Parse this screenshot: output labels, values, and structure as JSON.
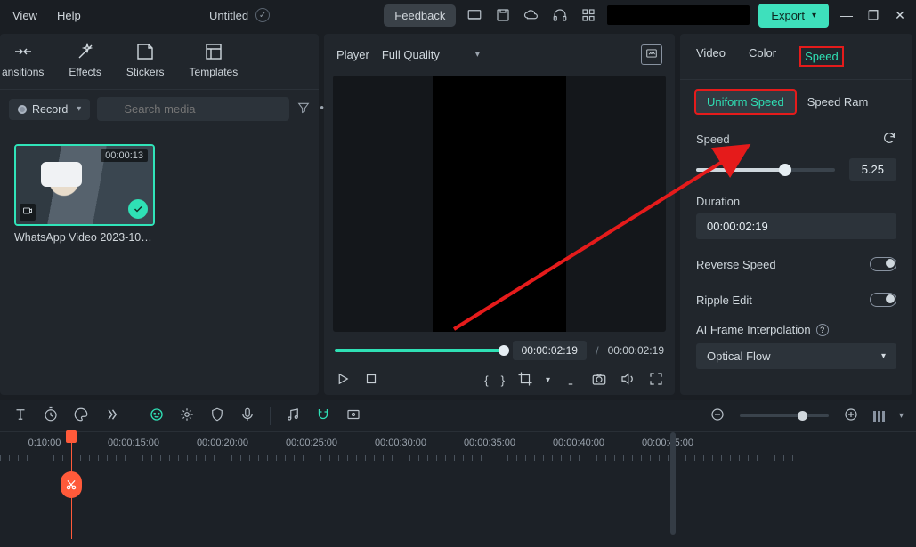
{
  "menubar": {
    "view": "View",
    "help": "Help",
    "title": "Untitled"
  },
  "topbar": {
    "feedback": "Feedback",
    "export": "Export"
  },
  "categories": {
    "transitions": "ansitions",
    "effects": "Effects",
    "stickers": "Stickers",
    "templates": "Templates"
  },
  "media": {
    "record": "Record",
    "search_placeholder": "Search media",
    "clip_duration": "00:00:13",
    "clip_name": "WhatsApp Video 2023-10-05..."
  },
  "player": {
    "label": "Player",
    "quality": "Full Quality",
    "time_current": "00:00:02:19",
    "time_total": "00:00:02:19"
  },
  "rpanel": {
    "tabs": {
      "video": "Video",
      "color": "Color",
      "speed": "Speed"
    },
    "uniform": "Uniform Speed",
    "speed_ramp": "Speed Ram",
    "speed_label": "Speed",
    "speed_value": "5.25",
    "duration_label": "Duration",
    "duration_value": "00:00:02:19",
    "reverse": "Reverse Speed",
    "ripple": "Ripple Edit",
    "interp_label": "AI Frame Interpolation",
    "interp_value": "Optical Flow"
  },
  "timeline": {
    "labels": [
      "0:10:00",
      "00:00:15:00",
      "00:00:20:00",
      "00:00:25:00",
      "00:00:30:00",
      "00:00:35:00",
      "00:00:40:00",
      "00:00:45:00"
    ]
  }
}
